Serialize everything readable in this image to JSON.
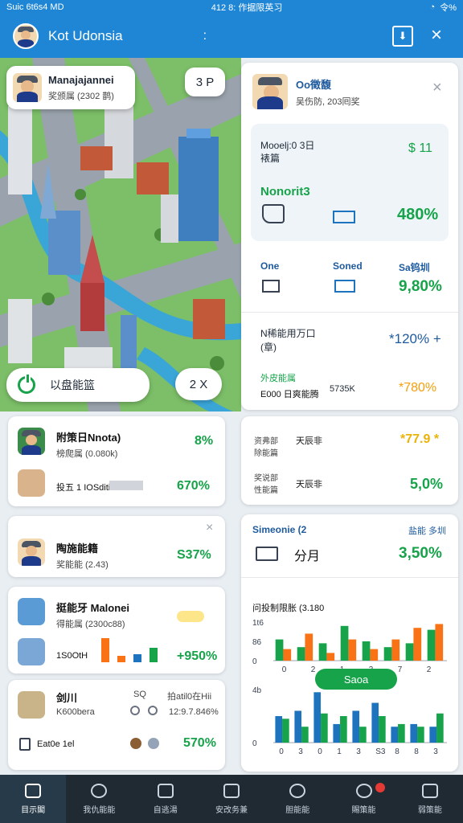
{
  "status_bar": {
    "left": "Suic 6t6s4 MD",
    "center": "412 8: 作据限英习",
    "right": "令%"
  },
  "app_bar": {
    "title": "Kot Udonsia",
    "menu": ":",
    "edit_icon": "edit-icon",
    "close": "×"
  },
  "map": {
    "profile": {
      "name": "Manajajannei",
      "sub": "奖颁属 (2302 鹊)"
    },
    "badge": "3 P",
    "action": {
      "label": "以盘能篮"
    },
    "count": "2 X"
  },
  "panel": {
    "name": "Oo徵馥",
    "sub": "吴伤防, 203囘奖",
    "inner": {
      "line1": "Mooelj:0 3日",
      "line2": "裱篇",
      "value1": "$ 11",
      "label": "Nonorit3",
      "value2": "480%"
    },
    "row3": {
      "h1": "One",
      "h2": "Soned",
      "h3": "Sa钨圳",
      "value": "9,80%"
    },
    "row4": {
      "line1": "N稀能用万口",
      "line2": "(章)",
      "value": "*120% +"
    },
    "row5": {
      "h": "外皮能属",
      "s": "E000 日爽能腾",
      "m": "5735K",
      "value": "*780%"
    }
  },
  "left_cards": [
    {
      "title": "附策日Nnota)",
      "sub": "榜爬属 (0.080k)",
      "value": "8%",
      "title2": "投五 1 IOSditi",
      "value2": "670%"
    },
    {
      "title": "陶施能籍",
      "sub": "奖能能 (2.43)",
      "value": "S37%",
      "close": "×"
    },
    {
      "title": "挺能牙 Malonei",
      "sub": "得能属 (2300c88)",
      "title2": "1S0OtH",
      "value2": "+950%"
    },
    {
      "title": "剑川",
      "sub": "K600bera",
      "col1": "SQ",
      "col2": "拍atil0在Hii",
      "col3": "12:9.7.846%",
      "title2": "Eat0e 1el",
      "value2": "570%"
    }
  ],
  "right_cards": [
    {
      "label1": "资弗部\n除能篇",
      "label1b": "天辰非",
      "value1": "*77.9 *",
      "label2": "奖说部\n性能篇",
      "label2b": "天辰非",
      "value2": "5,0%"
    },
    {
      "title": "Simeonie (2",
      "link": "盐能 多圳",
      "label": "分月",
      "value": "3,50%"
    }
  ],
  "chart_data": {
    "type": "bar",
    "title": "问投制限胀 (3.180",
    "button": "Saoa",
    "top": {
      "yticks": [
        "1t6",
        "86",
        "0"
      ],
      "xticks": [
        "0",
        "2",
        "1",
        "3",
        "7",
        "2"
      ],
      "series": [
        {
          "color": "#16a34a",
          "values": [
            0.55,
            0.35,
            0.45,
            0.9,
            0.5,
            0.35,
            0.45,
            0.8
          ]
        },
        {
          "color": "#f97316",
          "values": [
            0.3,
            0.7,
            0.2,
            0.55,
            0.3,
            0.55,
            0.85,
            0.95
          ]
        }
      ]
    },
    "bottom": {
      "yticks": [
        "4b",
        "0"
      ],
      "xticks": [
        "0",
        "3",
        "0",
        "1",
        "3",
        "S3",
        "8",
        "8",
        "3"
      ],
      "series": [
        {
          "color": "#1e73be",
          "values": [
            0.5,
            0.6,
            0.95,
            0.35,
            0.6,
            0.75,
            0.3,
            0.35,
            0.3
          ]
        },
        {
          "color": "#16a34a",
          "values": [
            0.45,
            0.3,
            0.55,
            0.5,
            0.3,
            0.5,
            0.35,
            0.3,
            0.55
          ]
        }
      ]
    }
  },
  "bottom_nav": [
    {
      "label": "目示閣",
      "icon": "home-icon"
    },
    {
      "label": "我仇能能",
      "icon": "clock-icon"
    },
    {
      "label": "自逃湯",
      "icon": "calendar-icon"
    },
    {
      "label": "安改务兼",
      "icon": "chat-icon"
    },
    {
      "label": "胆能能",
      "icon": "gear-icon"
    },
    {
      "label": "賜策能",
      "icon": "bell-icon"
    },
    {
      "label": "弱策能",
      "icon": "profile-icon"
    }
  ]
}
